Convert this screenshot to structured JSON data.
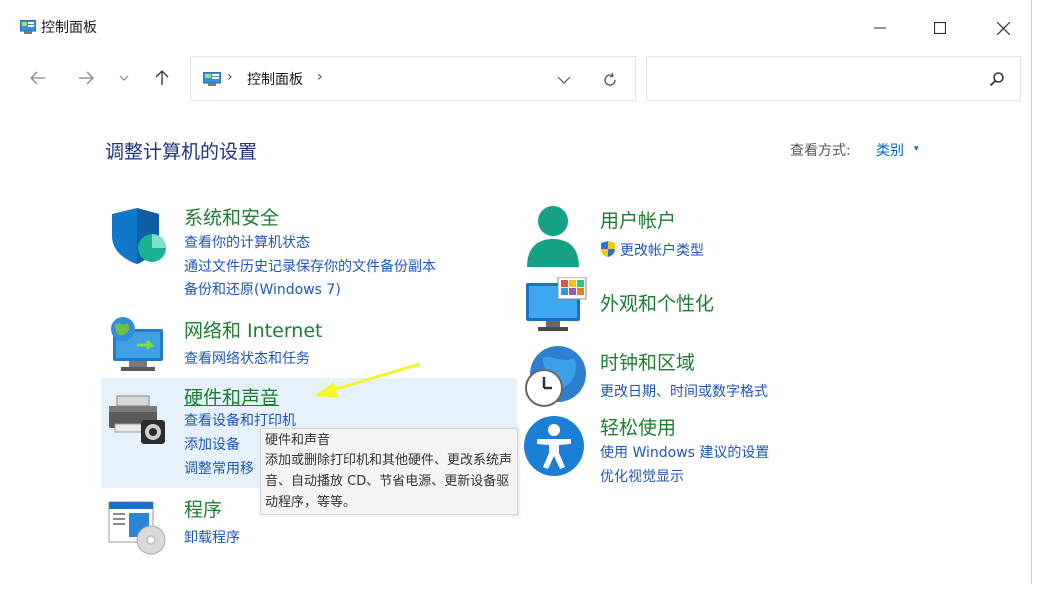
{
  "window": {
    "title": "控制面板"
  },
  "titlebar_buttons": {
    "minimize": "—",
    "maximize": "☐",
    "close": "✕"
  },
  "nav": {
    "back": "←",
    "forward": "→",
    "recent": "⌄",
    "up": "↑"
  },
  "address": {
    "separator": "›",
    "path": "控制面板"
  },
  "search": {
    "value": "",
    "placeholder": ""
  },
  "page": {
    "title": "调整计算机的设置",
    "view_by_label": "查看方式:",
    "view_by_value": "类别",
    "view_by_caret": "▾"
  },
  "categories": {
    "system_security": {
      "title": "系统和安全",
      "links": [
        "查看你的计算机状态",
        "通过文件历史记录保存你的文件备份副本",
        "备份和还原(Windows 7)"
      ]
    },
    "network": {
      "title": "网络和 Internet",
      "links": [
        "查看网络状态和任务"
      ]
    },
    "hardware": {
      "title": "硬件和声音",
      "links": [
        "查看设备和打印机",
        "添加设备",
        "调整常用移"
      ]
    },
    "programs": {
      "title": "程序",
      "links": [
        "卸载程序"
      ]
    },
    "user_accounts": {
      "title": "用户帐户",
      "links": [
        "更改帐户类型"
      ]
    },
    "appearance": {
      "title": "外观和个性化",
      "links": []
    },
    "clock_region": {
      "title": "时钟和区域",
      "links": [
        "更改日期、时间或数字格式"
      ]
    },
    "ease_of_access": {
      "title": "轻松使用",
      "links": [
        "使用 Windows 建议的设置",
        "优化视觉显示"
      ]
    }
  },
  "tooltip": {
    "title": "硬件和声音",
    "body": "添加或删除打印机和其他硬件、更改系统声音、自动播放 CD、节省电源、更新设备驱动程序，等等。"
  },
  "colors": {
    "category_title": "#1e7d32",
    "link": "#1f56b8",
    "heading": "#1e3287",
    "hover": "#e5f1fb",
    "annotation_arrow": "#f5f52a"
  }
}
